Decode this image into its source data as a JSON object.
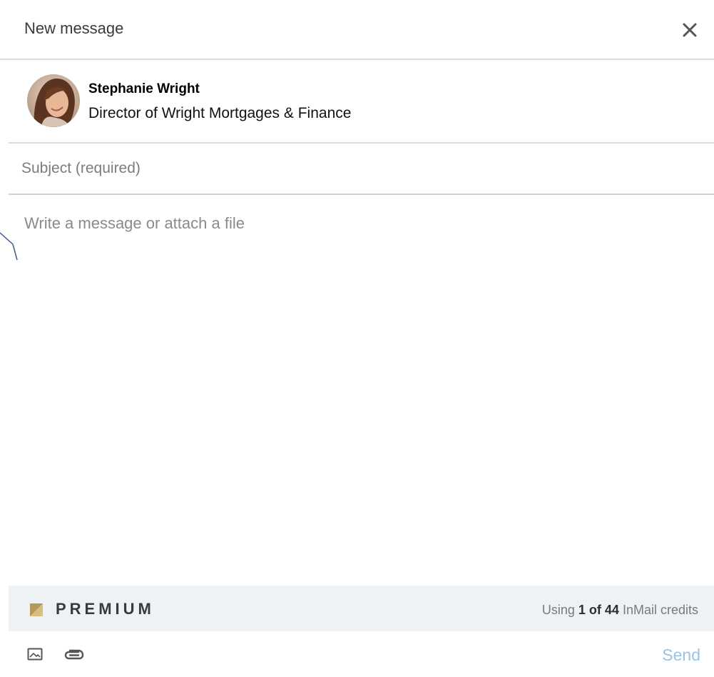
{
  "header": {
    "title": "New message",
    "close_icon": "close-icon"
  },
  "recipient": {
    "name": "Stephanie Wright",
    "headline": "Director of Wright Mortgages & Finance"
  },
  "subject": {
    "value": "",
    "placeholder": "Subject (required)"
  },
  "message": {
    "value": "",
    "placeholder": "Write a message or attach a file"
  },
  "premium": {
    "label": "PREMIUM",
    "badge_color": "#b3995a",
    "credits_prefix": "Using",
    "credits_used_text": "1 of 44",
    "credits_suffix": "InMail credits"
  },
  "toolbar": {
    "image_icon": "image-icon",
    "attach_icon": "paperclip-icon",
    "send_label": "Send",
    "send_color": "#9cc3e3"
  }
}
